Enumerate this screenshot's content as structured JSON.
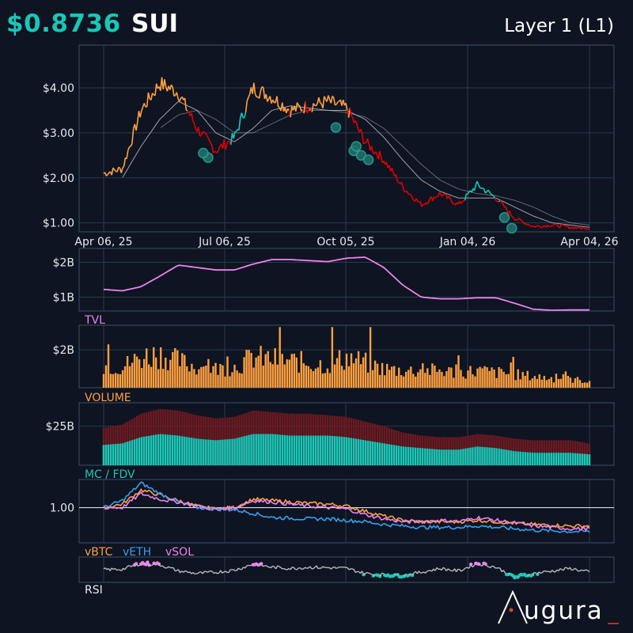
{
  "header": {
    "price": "$0.8736",
    "symbol": "SUI",
    "sector": "Layer 1 (L1)"
  },
  "brand": "ugura",
  "colors": {
    "up": "#ffa040",
    "down": "#e00000",
    "rebound": "#19c7b8",
    "ma": "#b9bcc2",
    "tvl": "#ee82ee",
    "volume": "#ffa040",
    "mc": "#19c7b8",
    "fdv": "#6b1a22",
    "vbtc": "#ffa040",
    "veth": "#35a0f0",
    "vsol": "#ee82ee",
    "rsi": "#b9bcc2"
  },
  "chart_data": [
    {
      "type": "line",
      "panel": "price",
      "x_ticks": [
        "Apr 06, 25",
        "Jul 06, 25",
        "Oct 05, 25",
        "Jan 04, 26",
        "Apr 04, 26"
      ],
      "y_ticks": [
        "$1.00",
        "$2.00",
        "$3.00",
        "$4.00"
      ],
      "ylim": [
        0.8,
        4.95
      ],
      "x": [
        "Apr 06, 25",
        "Apr 20, 25",
        "May 04, 25",
        "May 18, 25",
        "Jun 01, 25",
        "Jun 15, 25",
        "Jun 29, 25",
        "Jul 13, 25",
        "Jul 27, 25",
        "Aug 10, 25",
        "Aug 24, 25",
        "Sep 07, 25",
        "Sep 21, 25",
        "Oct 05, 25",
        "Oct 19, 25",
        "Nov 02, 25",
        "Nov 16, 25",
        "Nov 30, 25",
        "Dec 14, 25",
        "Dec 28, 25",
        "Jan 11, 26",
        "Jan 25, 26",
        "Feb 08, 26",
        "Feb 22, 26",
        "Mar 08, 26",
        "Mar 22, 26",
        "Apr 04, 26"
      ],
      "series": [
        {
          "values": [
            2.1,
            2.2,
            3.5,
            4.1,
            3.9,
            3.1,
            2.6,
            2.9,
            4.0,
            3.8,
            3.5,
            3.6,
            3.7,
            3.55,
            2.8,
            2.4,
            1.8,
            1.4,
            1.65,
            1.4,
            1.85,
            1.55,
            1.1,
            0.92,
            0.95,
            0.9,
            0.87
          ]
        },
        {
          "values": [
            null,
            2.0,
            2.7,
            3.3,
            3.7,
            3.5,
            3.0,
            2.8,
            3.1,
            3.5,
            3.6,
            3.55,
            3.5,
            3.5,
            3.3,
            2.9,
            2.4,
            1.95,
            1.7,
            1.55,
            1.55,
            1.55,
            1.35,
            1.15,
            1.0,
            0.95,
            0.9
          ]
        },
        {
          "values": [
            null,
            null,
            null,
            3.1,
            3.4,
            3.5,
            3.3,
            3.0,
            3.0,
            3.2,
            3.4,
            3.5,
            3.5,
            3.45,
            3.35,
            3.1,
            2.7,
            2.3,
            1.95,
            1.75,
            1.65,
            1.6,
            1.5,
            1.35,
            1.15,
            1.0,
            0.95
          ]
        }
      ]
    },
    {
      "type": "area",
      "panel": "tvl",
      "label": "TVL",
      "y_ticks": [
        "$1B",
        "$2B"
      ],
      "ylim": [
        0.6,
        2.4
      ],
      "values": [
        1.22,
        1.18,
        1.3,
        1.6,
        1.92,
        1.85,
        1.78,
        1.78,
        1.95,
        2.08,
        2.08,
        2.05,
        2.02,
        2.12,
        2.15,
        1.85,
        1.35,
        1.0,
        0.95,
        0.95,
        0.98,
        0.98,
        0.82,
        0.65,
        0.62,
        0.63,
        0.63
      ]
    },
    {
      "type": "bar",
      "panel": "volume",
      "label": "VOLUME",
      "y_ticks": [
        "$2B"
      ],
      "ylim": [
        0,
        3.3
      ]
    },
    {
      "type": "bar",
      "panel": "mcfdv",
      "label": "MC / FDV",
      "y_ticks": [
        "$25B"
      ],
      "ylim": [
        0,
        40
      ],
      "series": [
        {
          "name": "MC",
          "values": [
            13,
            14,
            18,
            20,
            19,
            17,
            16,
            17,
            20,
            20,
            19,
            19,
            19,
            18,
            16,
            14,
            12,
            11,
            10,
            10,
            12,
            11,
            9,
            8,
            8,
            8,
            7
          ]
        },
        {
          "name": "FDV",
          "values": [
            24,
            26,
            33,
            36,
            35,
            32,
            30,
            31,
            35,
            34,
            33,
            33,
            32,
            31,
            28,
            25,
            21,
            19,
            18,
            18,
            20,
            19,
            17,
            16,
            16,
            16,
            14
          ]
        }
      ]
    },
    {
      "type": "line",
      "panel": "relative",
      "y_ticks": [
        "1.00"
      ],
      "ylim": [
        0.5,
        1.4
      ],
      "series": [
        {
          "name": "vBTC",
          "values": [
            1.0,
            1.05,
            1.25,
            1.18,
            1.1,
            1.02,
            0.98,
            1.0,
            1.12,
            1.1,
            1.08,
            1.06,
            1.05,
            1.02,
            0.95,
            0.88,
            0.82,
            0.8,
            0.8,
            0.8,
            0.82,
            0.8,
            0.78,
            0.76,
            0.75,
            0.74,
            0.74
          ]
        },
        {
          "name": "vETH",
          "values": [
            1.0,
            1.1,
            1.35,
            1.2,
            1.08,
            1.0,
            0.98,
            0.97,
            0.92,
            0.86,
            0.85,
            0.84,
            0.84,
            0.82,
            0.8,
            0.76,
            0.74,
            0.72,
            0.72,
            0.72,
            0.74,
            0.72,
            0.7,
            0.68,
            0.67,
            0.66,
            0.66
          ]
        },
        {
          "name": "vSOL",
          "values": [
            1.0,
            1.0,
            1.2,
            1.12,
            1.08,
            1.02,
            0.98,
            1.0,
            1.1,
            1.08,
            1.05,
            1.02,
            1.0,
            0.98,
            0.9,
            0.84,
            0.8,
            0.8,
            0.82,
            0.8,
            0.86,
            0.82,
            0.78,
            0.74,
            0.72,
            0.7,
            0.7
          ]
        }
      ]
    },
    {
      "type": "line",
      "panel": "rsi",
      "label": "RSI",
      "ylim": [
        0,
        100
      ],
      "values": [
        50,
        52,
        75,
        70,
        45,
        35,
        40,
        48,
        72,
        60,
        55,
        60,
        58,
        55,
        35,
        30,
        28,
        40,
        55,
        45,
        75,
        60,
        20,
        35,
        45,
        55,
        40
      ]
    }
  ]
}
